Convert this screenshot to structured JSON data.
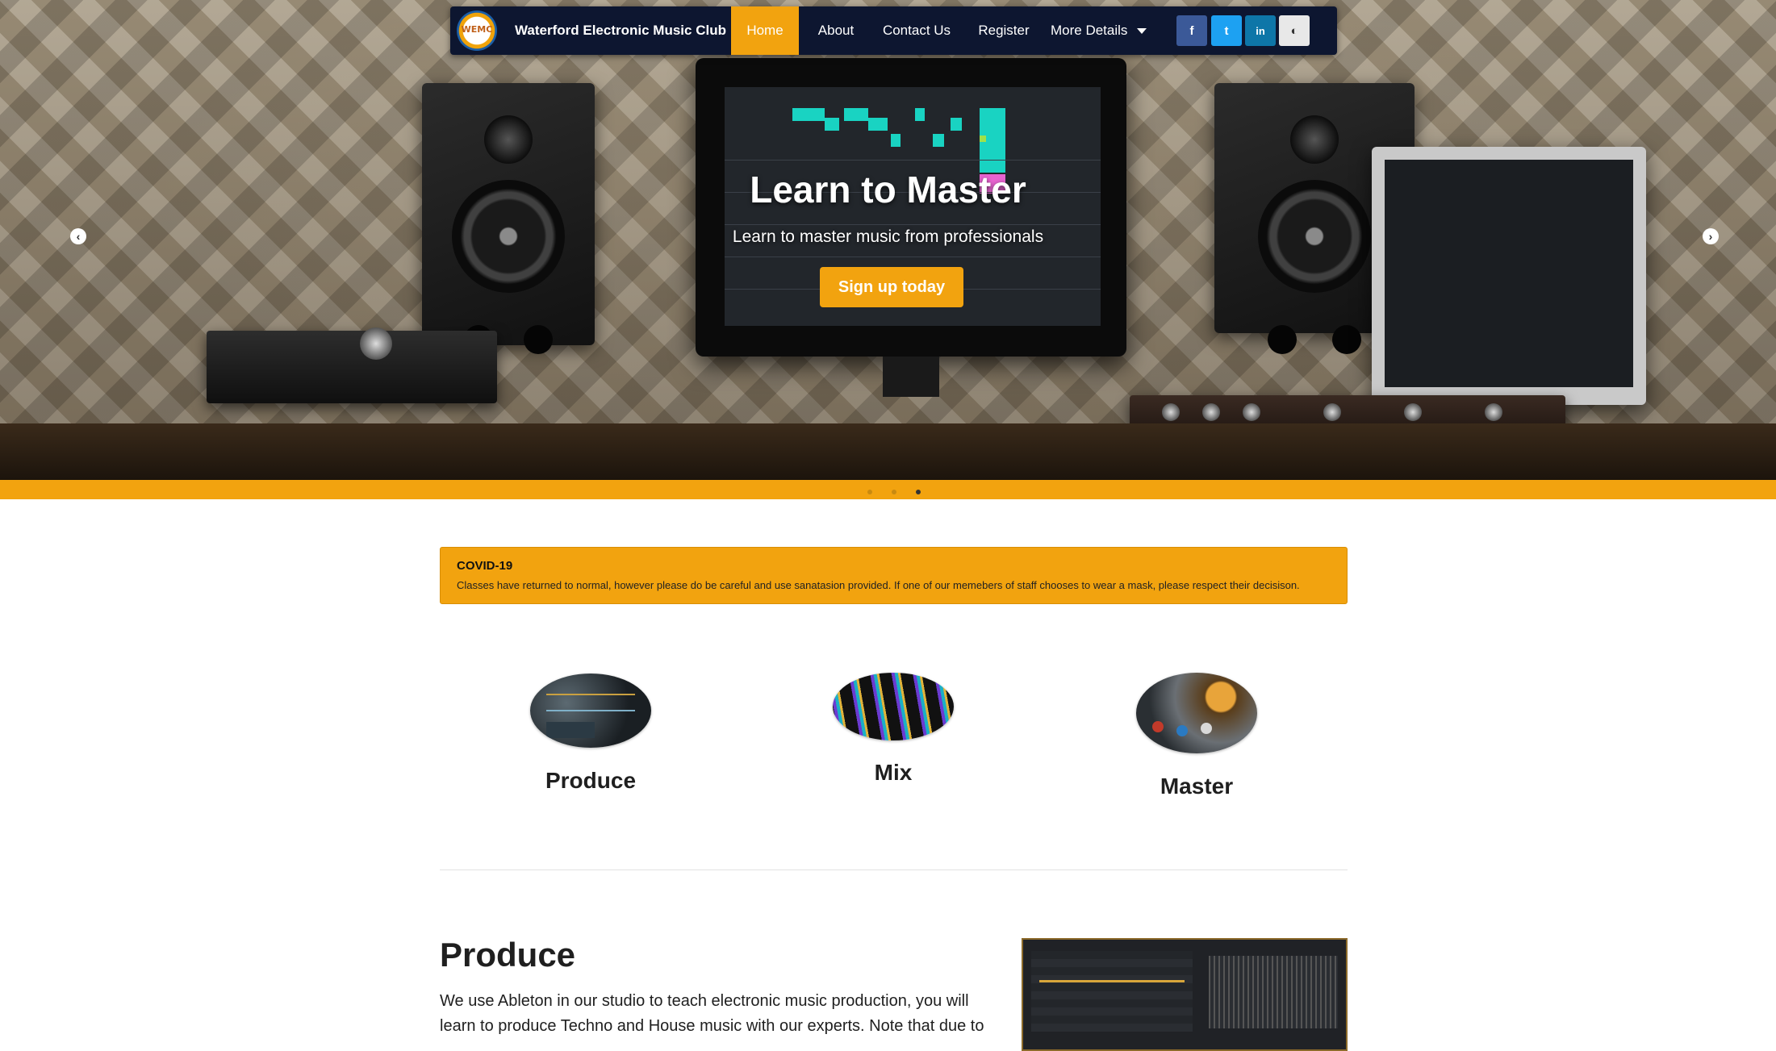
{
  "navbar": {
    "logo_text": "WEMC",
    "brand": "Waterford Electronic Music Club",
    "items": [
      {
        "label": "Home",
        "active": true
      },
      {
        "label": "About",
        "active": false
      },
      {
        "label": "Contact Us",
        "active": false
      },
      {
        "label": "Register",
        "active": false
      },
      {
        "label": "More Details",
        "active": false,
        "dropdown": true
      }
    ],
    "social": [
      {
        "icon": "facebook-icon",
        "glyph": "f",
        "color": "#3b5998"
      },
      {
        "icon": "twitter-icon",
        "glyph": "t",
        "color": "#1da1f2"
      },
      {
        "icon": "linkedin-icon",
        "glyph": "in",
        "color": "#0e76a8"
      },
      {
        "icon": "contrast-toggle-icon",
        "glyph": "◐",
        "color": "#e8e8e8"
      }
    ]
  },
  "hero": {
    "title": "Learn to Master",
    "subtitle": "Learn to master music from professionals",
    "button": "Sign up today",
    "prev_icon": "chevron-left-icon",
    "next_icon": "chevron-right-icon",
    "prev_glyph": "‹",
    "next_glyph": "›",
    "slides": 3,
    "active_slide": 3
  },
  "alert": {
    "title": "COVID-19",
    "text": "Classes have returned to normal, however please do be careful and use sanatasion provided. If one of our memebers of staff chooses to wear a mask, please respect their decisison."
  },
  "features": [
    {
      "label": "Produce"
    },
    {
      "label": "Mix"
    },
    {
      "label": "Master"
    }
  ],
  "produce": {
    "title": "Produce",
    "text": "We use Ableton in our studio to teach electronic music production, you will learn to produce Techno and House music with our experts. Note that due to"
  },
  "colors": {
    "accent": "#f2a30f",
    "navbar": "#0d1630"
  }
}
